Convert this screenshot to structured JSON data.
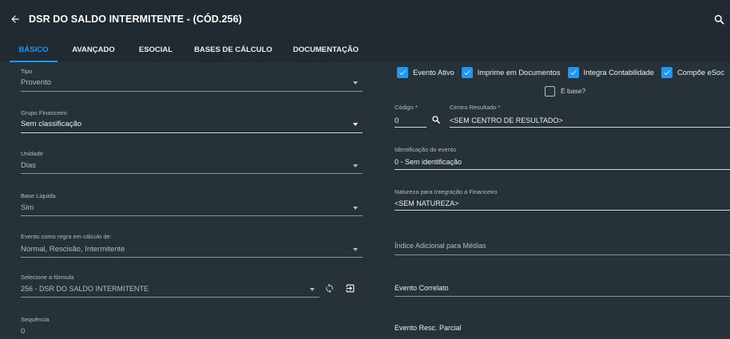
{
  "appbar": {
    "title": "DSR DO SALDO INTERMITENTE - (CÓD.256)",
    "back_icon": "arrow-left-icon",
    "search_icon": "search-icon"
  },
  "tabs": [
    {
      "label": "BÁSICO",
      "active": true
    },
    {
      "label": "AVANÇADO",
      "active": false
    },
    {
      "label": "ESOCIAL",
      "active": false
    },
    {
      "label": "BASES DE CÁLCULO",
      "active": false
    },
    {
      "label": "DOCUMENTAÇÃO",
      "active": false
    }
  ],
  "left": {
    "tipo": {
      "label": "Tipo",
      "value": "Provento"
    },
    "grupo": {
      "label": "Grupo Financeiro",
      "value": "Sem classificação"
    },
    "unidade": {
      "label": "Unidade",
      "value": "Dias"
    },
    "base_liquida": {
      "label": "Base Liquida",
      "value": "Sim"
    },
    "evento_regra": {
      "label": "Evento como regra em cálculo de:",
      "value": "Normal, Rescisão, Intermitente"
    },
    "formula": {
      "label": "Selecione a fórmula",
      "value": "256 - DSR DO SALDO INTERMITENTE"
    },
    "sequencia": {
      "label": "Sequência",
      "value": "0"
    }
  },
  "checkboxes": [
    {
      "label": "Evento Ativo",
      "checked": true
    },
    {
      "label": "Imprime em Documentos",
      "checked": true
    },
    {
      "label": "Integra Contabilidade",
      "checked": true
    },
    {
      "label": "Compõe eSoc",
      "checked": true
    }
  ],
  "e_base": {
    "label": "É base?",
    "checked": false
  },
  "right": {
    "codigo": {
      "label": "Código *",
      "value": "0"
    },
    "centro": {
      "label": "Centro Resultado *",
      "value": "<SEM CENTRO DE RESULTADO>"
    },
    "identificacao": {
      "label": "Identificação do evento",
      "value": "0 - Sem identificação"
    },
    "natureza": {
      "label": "Natureza para Integração a Financeiro",
      "value": "<SEM NATUREZA>"
    },
    "indice": {
      "placeholder": "Índice Adicional para Médias"
    },
    "correlato": {
      "label": "Evento Correlato"
    },
    "resc_parcial": {
      "label": "Evento Resc. Parcial"
    }
  },
  "colors": {
    "accent": "#2196f3",
    "background": "#263238",
    "appbar": "#212a30"
  }
}
